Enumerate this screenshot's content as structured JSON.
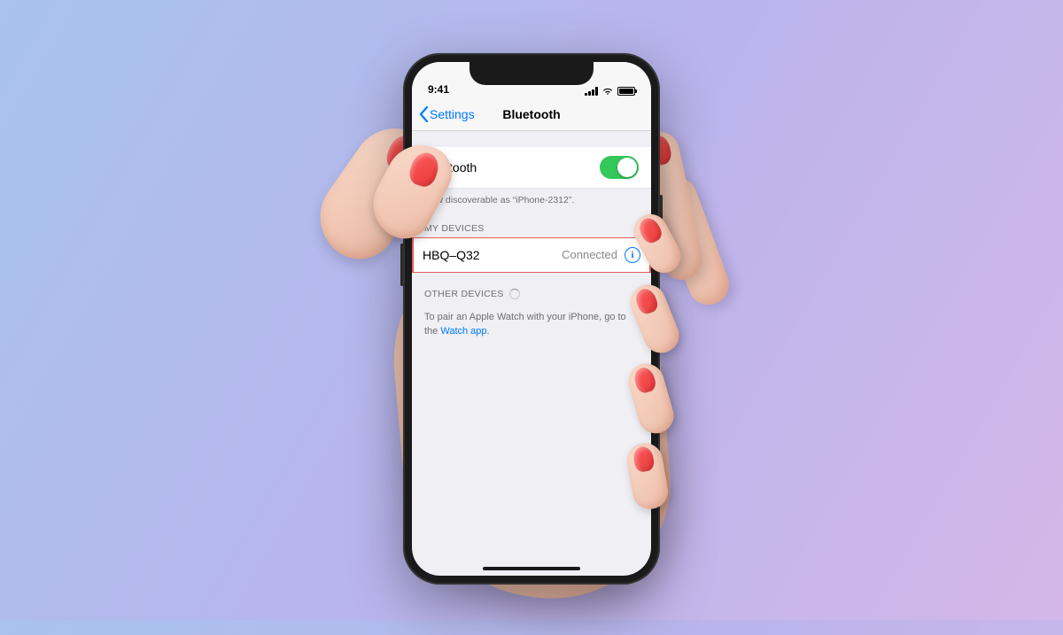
{
  "status_bar": {
    "time": "9:41"
  },
  "nav": {
    "back_label": "Settings",
    "title": "Bluetooth"
  },
  "bluetooth_toggle": {
    "label": "Bluetooth",
    "on": true
  },
  "discoverable_text": "Now discoverable as “iPhone-2312”.",
  "sections": {
    "my_devices_header": "MY DEVICES",
    "other_devices_header": "OTHER DEVICES"
  },
  "my_devices": [
    {
      "name": "HBQ–Q32",
      "status": "Connected",
      "highlighted": true
    }
  ],
  "pair_hint": {
    "prefix": "To pair an Apple Watch with your iPhone, go to the ",
    "link_label": "Watch app",
    "suffix": "."
  },
  "colors": {
    "ios_blue": "#007aff",
    "toggle_green": "#34c759",
    "highlight_border": "#e85a5a"
  }
}
